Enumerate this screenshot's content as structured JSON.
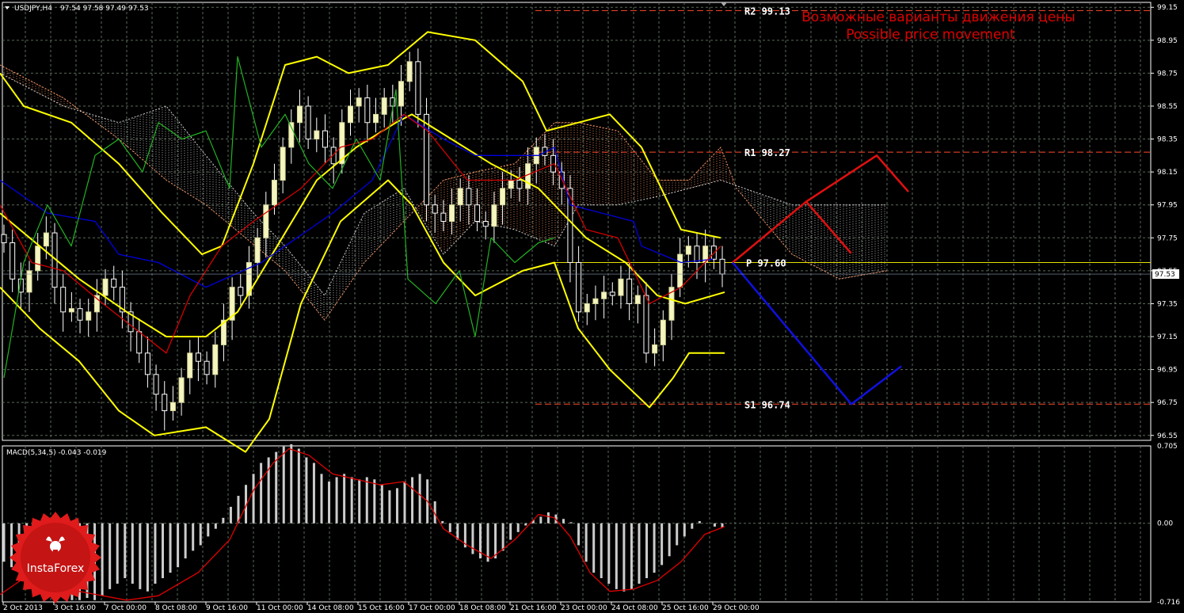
{
  "header": {
    "symbol": "USDJPY,H4",
    "ohlc": "97.54 97.58 97.49 97.53"
  },
  "annotations": {
    "ru": "Возможные варианты движения цены",
    "en": "Possible price movement"
  },
  "logo": {
    "text": "InstaForex",
    "icon": "bull-head-icon"
  },
  "colors": {
    "background": "#000000",
    "grid": "#5a6a5a",
    "bull_candle": "#f5f5c0",
    "bear_candle": "#ffffff",
    "bollinger": "#ffff00",
    "tenkan": "#d40000",
    "kijun": "#0000e0",
    "chikou": "#22b222",
    "kumo_a": "#ff9966",
    "kumo_b": "#cccccc",
    "pivot": "#e6e000",
    "levels": "#ff4a2a",
    "scenario_up": "#e01010",
    "scenario_down": "#1010e0",
    "macd_hist": "#cccccc",
    "macd_signal": "#e00000"
  },
  "chart_data": [
    {
      "type": "candlestick",
      "title": "USDJPY,H4",
      "ylim": [
        96.52,
        99.18
      ],
      "y_ticks": [
        "99.15",
        "98.95",
        "98.75",
        "98.55",
        "98.35",
        "98.15",
        "97.95",
        "97.75",
        "97.55",
        "97.35",
        "97.15",
        "96.95",
        "96.75",
        "96.55"
      ],
      "x_ticks": [
        "2 Oct 2013",
        "3 Oct 16:00",
        "7 Oct 00:00",
        "8 Oct 08:00",
        "9 Oct 16:00",
        "11 Oct 00:00",
        "14 Oct 08:00",
        "15 Oct 16:00",
        "17 Oct 00:00",
        "18 Oct 08:00",
        "21 Oct 16:00",
        "23 Oct 00:00",
        "24 Oct 08:00",
        "25 Oct 16:00",
        "29 Oct 00:00"
      ],
      "current_price": "97.53",
      "levels": [
        {
          "name": "R2",
          "label": "R2 99.13",
          "value": 99.13
        },
        {
          "name": "R1",
          "label": "R1 98.27",
          "value": 98.27
        },
        {
          "name": "P",
          "label": "P 97.60",
          "value": 97.6
        },
        {
          "name": "S1",
          "label": "S1 96.74",
          "value": 96.74
        }
      ],
      "close_path": [
        97.72,
        97.5,
        97.42,
        97.55,
        97.7,
        97.78,
        97.45,
        97.3,
        97.32,
        97.25,
        97.3,
        97.4,
        97.5,
        97.45,
        97.3,
        97.18,
        97.05,
        96.92,
        96.8,
        96.7,
        96.75,
        96.9,
        97.05,
        97.0,
        96.92,
        97.1,
        97.25,
        97.45,
        97.4,
        97.6,
        97.75,
        97.95,
        98.1,
        98.3,
        98.45,
        98.55,
        98.35,
        98.4,
        98.3,
        98.2,
        98.45,
        98.55,
        98.6,
        98.45,
        98.5,
        98.6,
        98.55,
        98.7,
        98.82,
        98.5,
        97.95,
        97.9,
        97.85,
        97.95,
        98.05,
        97.95,
        97.85,
        97.82,
        97.95,
        98.05,
        98.1,
        98.05,
        98.2,
        98.3,
        98.25,
        98.15,
        98.05,
        97.6,
        97.3,
        97.35,
        97.38,
        97.42,
        97.4,
        97.5,
        97.35,
        97.4,
        97.05,
        97.1,
        97.25,
        97.45,
        97.65,
        97.7,
        97.6,
        97.7,
        97.62,
        97.53
      ],
      "bollinger": {
        "period": 20,
        "upper": [
          [
            98.75,
            0
          ],
          [
            98.55,
            30
          ],
          [
            98.45,
            90
          ],
          [
            98.2,
            150
          ],
          [
            97.9,
            205
          ],
          [
            97.65,
            255
          ],
          [
            97.7,
            280
          ],
          [
            98.2,
            320
          ],
          [
            98.8,
            360
          ],
          [
            98.85,
            400
          ],
          [
            98.75,
            440
          ],
          [
            98.8,
            490
          ],
          [
            99.0,
            540
          ],
          [
            98.95,
            600
          ],
          [
            98.7,
            660
          ],
          [
            98.4,
            690
          ],
          [
            98.45,
            730
          ],
          [
            98.5,
            770
          ],
          [
            98.3,
            810
          ],
          [
            97.8,
            860
          ],
          [
            97.75,
            910
          ]
        ],
        "middle": [
          [
            97.9,
            0
          ],
          [
            97.7,
            50
          ],
          [
            97.5,
            100
          ],
          [
            97.3,
            160
          ],
          [
            97.15,
            210
          ],
          [
            97.15,
            260
          ],
          [
            97.3,
            300
          ],
          [
            97.7,
            350
          ],
          [
            98.1,
            400
          ],
          [
            98.3,
            450
          ],
          [
            98.45,
            500
          ],
          [
            98.5,
            520
          ],
          [
            98.35,
            570
          ],
          [
            98.2,
            620
          ],
          [
            98.05,
            680
          ],
          [
            97.75,
            740
          ],
          [
            97.6,
            790
          ],
          [
            97.4,
            830
          ],
          [
            97.35,
            865
          ],
          [
            97.42,
            915
          ]
        ],
        "lower": [
          [
            97.45,
            0
          ],
          [
            97.2,
            50
          ],
          [
            97.0,
            100
          ],
          [
            96.7,
            150
          ],
          [
            96.55,
            195
          ],
          [
            96.6,
            260
          ],
          [
            96.45,
            310
          ],
          [
            96.65,
            340
          ],
          [
            97.35,
            380
          ],
          [
            97.85,
            430
          ],
          [
            98.1,
            490
          ],
          [
            97.95,
            520
          ],
          [
            97.6,
            560
          ],
          [
            97.4,
            600
          ],
          [
            97.55,
            660
          ],
          [
            97.6,
            700
          ],
          [
            97.2,
            730
          ],
          [
            96.95,
            770
          ],
          [
            96.72,
            820
          ],
          [
            96.9,
            850
          ],
          [
            97.05,
            870
          ],
          [
            97.05,
            915
          ]
        ]
      },
      "ichimoku": {
        "kijun": [
          [
            98.1,
            0
          ],
          [
            97.9,
            60
          ],
          [
            97.85,
            120
          ],
          [
            97.65,
            150
          ],
          [
            97.6,
            200
          ],
          [
            97.45,
            260
          ],
          [
            97.6,
            330
          ],
          [
            97.9,
            420
          ],
          [
            98.1,
            470
          ],
          [
            98.5,
            510
          ],
          [
            98.35,
            560
          ],
          [
            98.25,
            600
          ],
          [
            98.25,
            680
          ],
          [
            98.3,
            700
          ],
          [
            97.95,
            720
          ],
          [
            97.85,
            800
          ],
          [
            97.7,
            810
          ],
          [
            97.6,
            860
          ],
          [
            97.62,
            900
          ]
        ],
        "tenkan": [
          [
            97.95,
            0
          ],
          [
            97.6,
            40
          ],
          [
            97.55,
            80
          ],
          [
            97.35,
            130
          ],
          [
            97.2,
            170
          ],
          [
            97.05,
            210
          ],
          [
            97.4,
            240
          ],
          [
            97.7,
            280
          ],
          [
            97.85,
            320
          ],
          [
            98.05,
            380
          ],
          [
            98.3,
            430
          ],
          [
            98.35,
            470
          ],
          [
            98.5,
            510
          ],
          [
            98.4,
            540
          ],
          [
            98.1,
            590
          ],
          [
            98.1,
            650
          ],
          [
            98.2,
            700
          ],
          [
            97.8,
            740
          ],
          [
            97.75,
            780
          ],
          [
            97.35,
            820
          ],
          [
            97.45,
            860
          ],
          [
            97.7,
            910
          ]
        ],
        "chikou": [
          [
            96.9,
            5
          ],
          [
            97.6,
            30
          ],
          [
            97.95,
            60
          ],
          [
            97.7,
            90
          ],
          [
            98.25,
            120
          ],
          [
            98.35,
            150
          ],
          [
            98.15,
            180
          ],
          [
            98.45,
            200
          ],
          [
            98.35,
            230
          ],
          [
            98.4,
            260
          ],
          [
            98.05,
            290
          ],
          [
            98.85,
            300
          ],
          [
            98.3,
            330
          ],
          [
            98.5,
            360
          ],
          [
            98.2,
            390
          ],
          [
            98.05,
            420
          ],
          [
            98.35,
            450
          ],
          [
            98.1,
            480
          ],
          [
            98.65,
            500
          ],
          [
            97.5,
            515
          ],
          [
            97.35,
            550
          ],
          [
            97.55,
            580
          ],
          [
            97.15,
            600
          ],
          [
            97.75,
            620
          ],
          [
            97.6,
            650
          ],
          [
            97.72,
            680
          ],
          [
            97.75,
            700
          ]
        ],
        "span_a": [
          [
            98.8,
            0
          ],
          [
            98.6,
            80
          ],
          [
            98.35,
            150
          ],
          [
            98.1,
            210
          ],
          [
            97.95,
            260
          ],
          [
            97.75,
            310
          ],
          [
            97.55,
            360
          ],
          [
            97.25,
            410
          ],
          [
            97.6,
            460
          ],
          [
            97.85,
            510
          ],
          [
            98.1,
            560
          ],
          [
            98.15,
            600
          ],
          [
            98.2,
            650
          ],
          [
            98.45,
            700
          ],
          [
            98.45,
            730
          ],
          [
            98.4,
            780
          ],
          [
            98.1,
            830
          ],
          [
            98.1,
            870
          ],
          [
            98.3,
            910
          ],
          [
            98.05,
            930
          ],
          [
            97.65,
            1000
          ],
          [
            97.5,
            1060
          ],
          [
            97.55,
            1120
          ]
        ],
        "span_b": [
          [
            98.75,
            0
          ],
          [
            98.55,
            80
          ],
          [
            98.45,
            150
          ],
          [
            98.55,
            210
          ],
          [
            98.25,
            260
          ],
          [
            97.9,
            320
          ],
          [
            97.7,
            360
          ],
          [
            97.4,
            410
          ],
          [
            97.9,
            460
          ],
          [
            98.05,
            510
          ],
          [
            97.65,
            560
          ],
          [
            97.85,
            600
          ],
          [
            97.8,
            650
          ],
          [
            97.7,
            700
          ],
          [
            97.95,
            730
          ],
          [
            97.95,
            780
          ],
          [
            98.0,
            830
          ],
          [
            98.05,
            870
          ],
          [
            98.1,
            910
          ],
          [
            98.05,
            940
          ],
          [
            97.95,
            1000
          ],
          [
            97.95,
            1060
          ],
          [
            97.95,
            1120
          ]
        ]
      },
      "scenarios": {
        "up": [
          [
            97.6,
            925
          ],
          [
            97.97,
            1018
          ],
          [
            97.66,
            1074
          ],
          [
            97.97,
            1018
          ],
          [
            98.25,
            1107
          ],
          [
            98.03,
            1147
          ]
        ],
        "down": [
          [
            97.6,
            925
          ],
          [
            96.74,
            1075
          ],
          [
            96.97,
            1138
          ]
        ]
      }
    },
    {
      "type": "bar",
      "title": "MACD(5,34,5) -0.043 -0.019",
      "ylim": [
        -0.716,
        0.705
      ],
      "y_ticks": [
        "0.705",
        "0.00",
        "-0.716"
      ],
      "histogram": [
        -0.35,
        -0.4,
        -0.45,
        -0.5,
        -0.55,
        -0.6,
        -0.62,
        -0.65,
        -0.68,
        -0.7,
        -0.7,
        -0.68,
        -0.7,
        -0.66,
        -0.6,
        -0.55,
        -0.5,
        -0.55,
        -0.6,
        -0.62,
        -0.55,
        -0.5,
        -0.45,
        -0.4,
        -0.32,
        -0.25,
        -0.2,
        -0.12,
        -0.05,
        0.05,
        0.15,
        0.25,
        0.35,
        0.45,
        0.55,
        0.6,
        0.65,
        0.7,
        0.72,
        0.68,
        0.6,
        0.55,
        0.45,
        0.38,
        0.42,
        0.45,
        0.42,
        0.4,
        0.42,
        0.4,
        0.35,
        0.3,
        0.32,
        0.38,
        0.42,
        0.45,
        0.4,
        0.2,
        0.02,
        -0.08,
        -0.15,
        -0.22,
        -0.28,
        -0.32,
        -0.35,
        -0.32,
        -0.25,
        -0.15,
        -0.08,
        -0.02,
        0.03,
        0.06,
        0.1,
        0.08,
        0.04,
        0.01,
        -0.2,
        -0.35,
        -0.45,
        -0.5,
        -0.55,
        -0.6,
        -0.62,
        -0.6,
        -0.55,
        -0.5,
        -0.45,
        -0.38,
        -0.3,
        -0.2,
        -0.12,
        -0.05,
        0.02,
        0.0,
        -0.03,
        -0.04
      ],
      "signal": [
        [
          -0.65,
          0
        ],
        [
          -0.5,
          30
        ],
        [
          -0.5,
          60
        ],
        [
          -0.62,
          100
        ],
        [
          -0.7,
          160
        ],
        [
          -0.66,
          200
        ],
        [
          -0.45,
          250
        ],
        [
          -0.15,
          290
        ],
        [
          0.3,
          320
        ],
        [
          0.55,
          345
        ],
        [
          0.68,
          365
        ],
        [
          0.62,
          390
        ],
        [
          0.45,
          420
        ],
        [
          0.4,
          450
        ],
        [
          0.35,
          480
        ],
        [
          0.38,
          510
        ],
        [
          0.2,
          540
        ],
        [
          -0.05,
          560
        ],
        [
          -0.2,
          590
        ],
        [
          -0.32,
          620
        ],
        [
          -0.15,
          650
        ],
        [
          0.08,
          680
        ],
        [
          0.05,
          700
        ],
        [
          -0.12,
          720
        ],
        [
          -0.45,
          745
        ],
        [
          -0.62,
          770
        ],
        [
          -0.6,
          800
        ],
        [
          -0.52,
          830
        ],
        [
          -0.35,
          860
        ],
        [
          -0.1,
          890
        ],
        [
          -0.03,
          915
        ]
      ]
    }
  ]
}
